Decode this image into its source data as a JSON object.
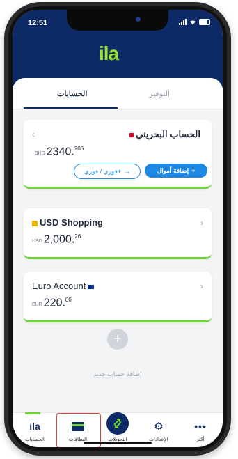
{
  "status": {
    "time": "12:51"
  },
  "brand": {
    "logo_text": "ila"
  },
  "tabs": {
    "accounts": "الحسابات",
    "savings": "التوفير"
  },
  "cards": [
    {
      "title": "الحساب البحريني",
      "currency": "BHD",
      "balance_int": "2340.",
      "balance_dec": "206",
      "primary_button": "إضافة أموال",
      "secondary_button": "فوري / فوري+"
    },
    {
      "title": "USD Shopping",
      "currency": "USD",
      "balance_int": "2,000.",
      "balance_dec": "26"
    },
    {
      "title": "Euro Account",
      "currency": "EUR",
      "balance_int": "220.",
      "balance_dec": "00"
    }
  ],
  "add_account": {
    "label": "إضافة حساب جديد",
    "icon": "plus-icon"
  },
  "bottom_nav": [
    {
      "label": "الحسابات",
      "icon": "ila-logo-icon"
    },
    {
      "label": "البطاقات",
      "icon": "card-icon"
    },
    {
      "label": "التحويلات",
      "icon": "transfer-arrows-icon"
    },
    {
      "label": "الإعدادات",
      "icon": "gear-icon"
    },
    {
      "label": "أكثر",
      "icon": "more-dots-icon"
    }
  ],
  "colors": {
    "navy": "#0d2a66",
    "green": "#6fd23a",
    "logo_green": "#9be32a",
    "blue": "#1e88e5",
    "highlight": "#e53935"
  }
}
